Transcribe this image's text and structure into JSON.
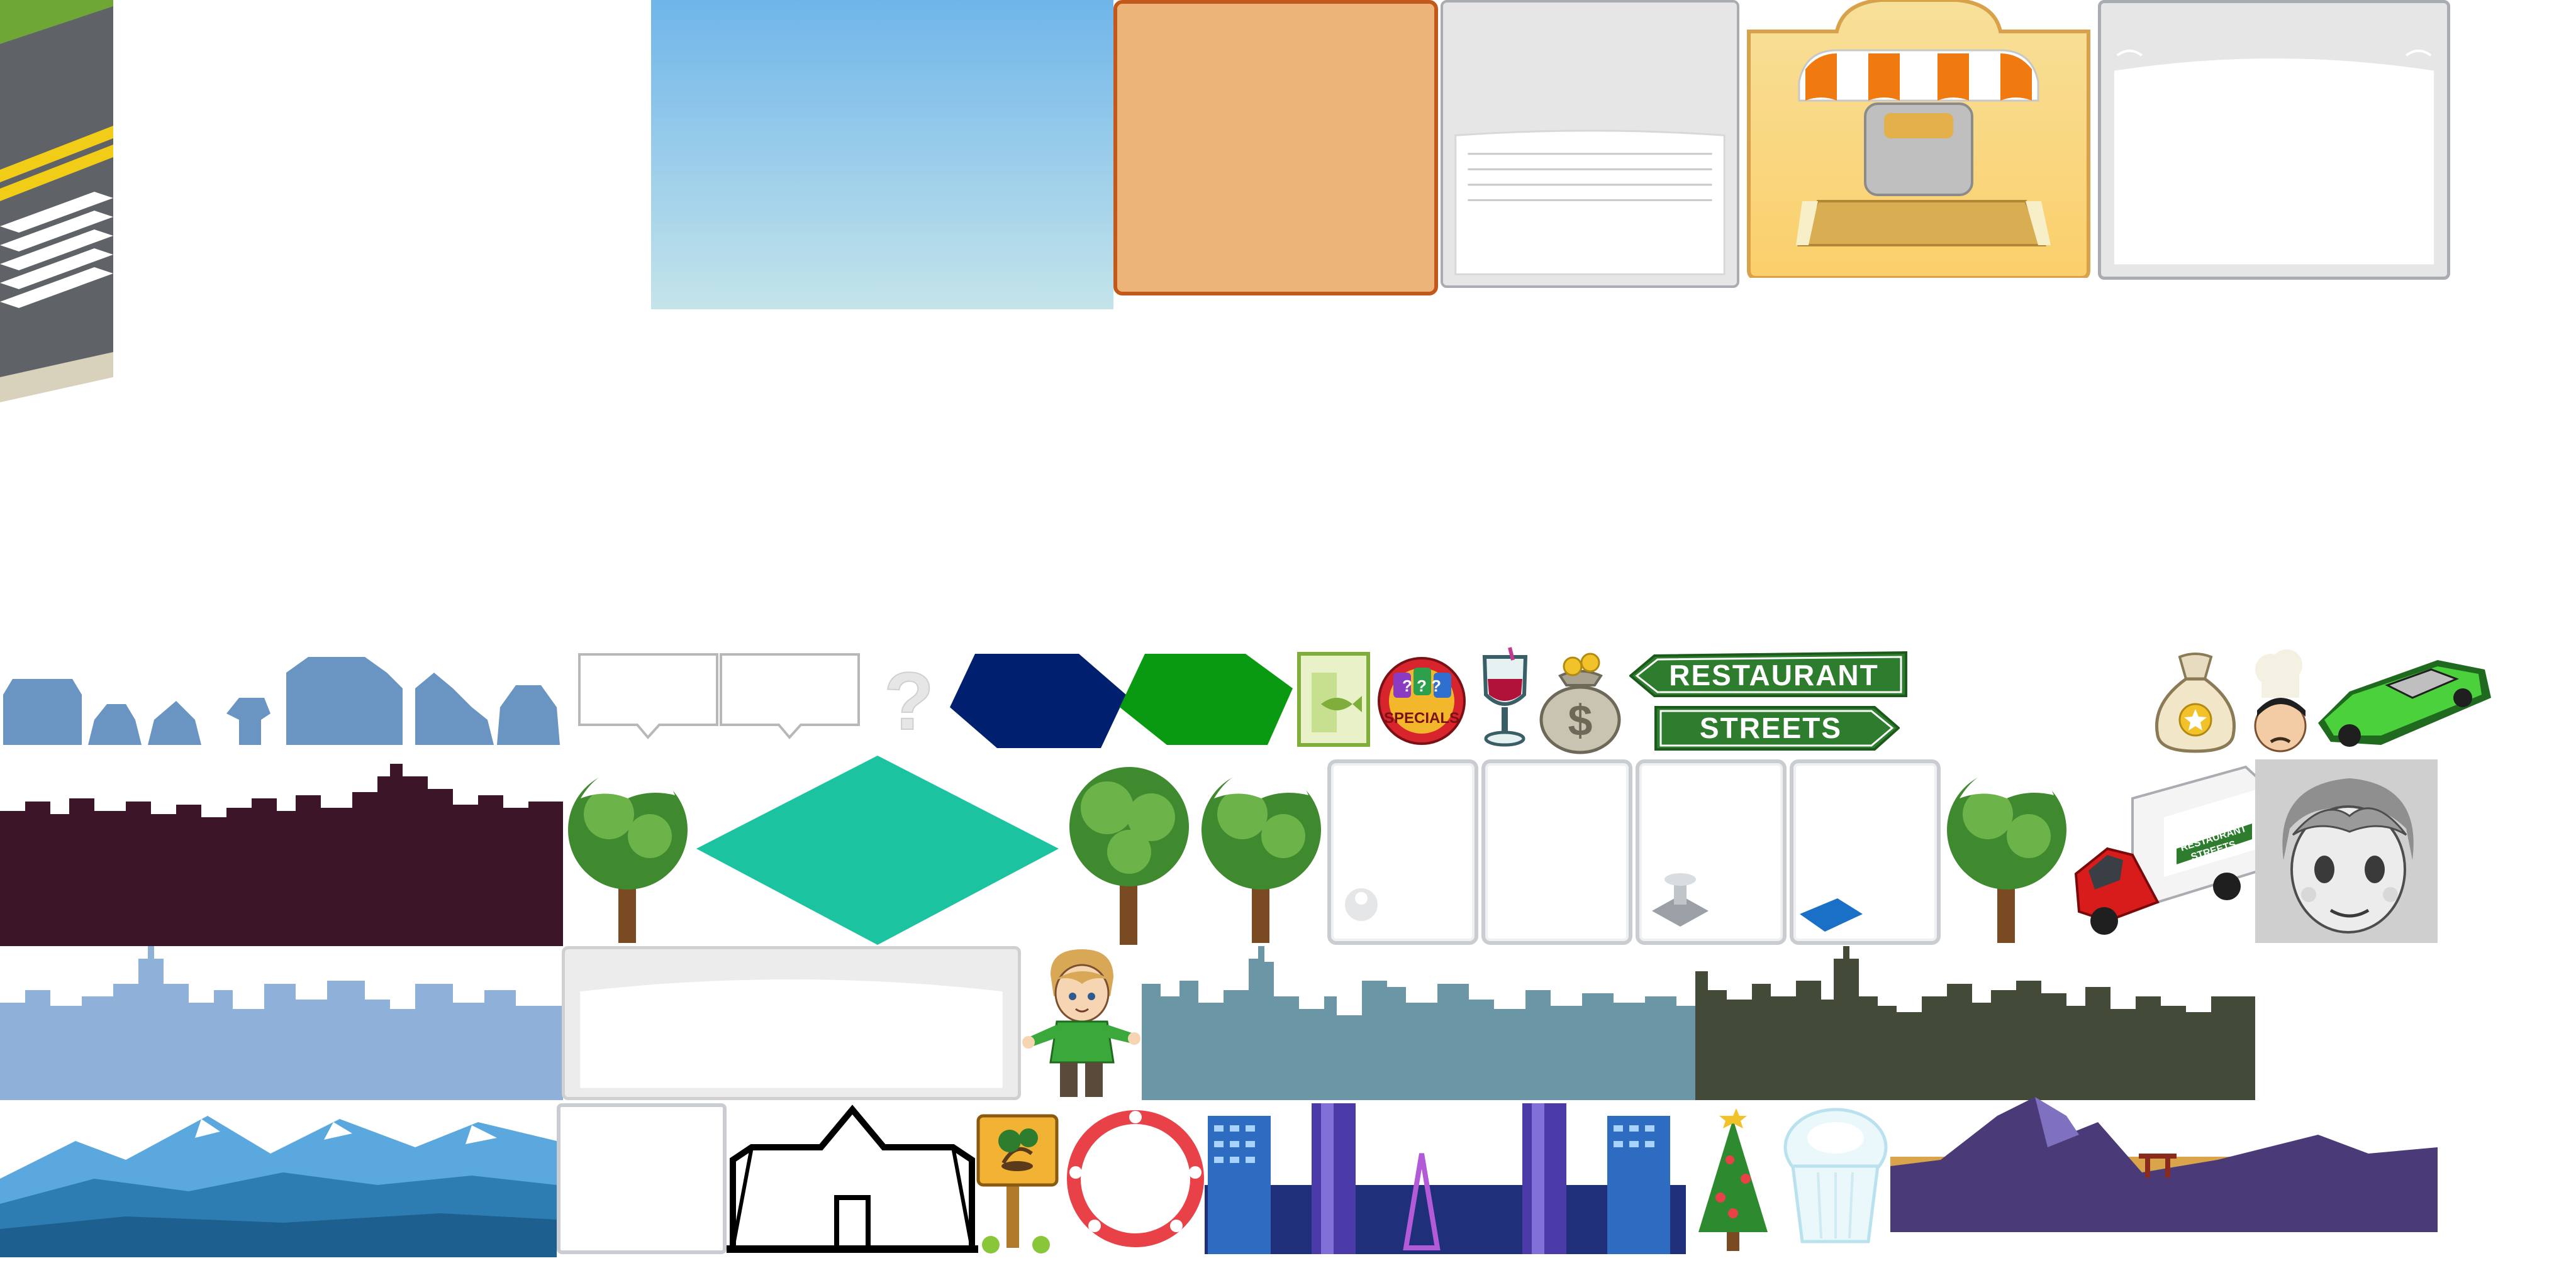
{
  "sheet": {
    "title": "",
    "background": "#ffffff"
  },
  "signs": {
    "line1": "RESTAURANT",
    "line2": "STREETS",
    "color": "#2e7d2e"
  },
  "truck": {
    "side_line1": "RESTAURANT",
    "side_line2": "STREETS"
  },
  "specials_badge": {
    "label": "SPECIALS",
    "marks": "? ? ?"
  },
  "money_bag": {
    "symbol": "$"
  },
  "question_mark": {
    "symbol": "?"
  },
  "colors": {
    "sky_top": "#6fb5ea",
    "sky_bottom": "#c4e4ea",
    "orange_panel": "#ecb478",
    "orange_border": "#c2591a",
    "navy_tile": "#001f6e",
    "green_tile": "#0a9a12",
    "teal_tile": "#1cc3a0",
    "dark_skyline": "#3c1528",
    "blue_skyline": "#8fb0d9",
    "slate_skyline": "#6a96a6",
    "olive_skyline": "#434a37",
    "silhouette_blue": "#6a95c2"
  }
}
